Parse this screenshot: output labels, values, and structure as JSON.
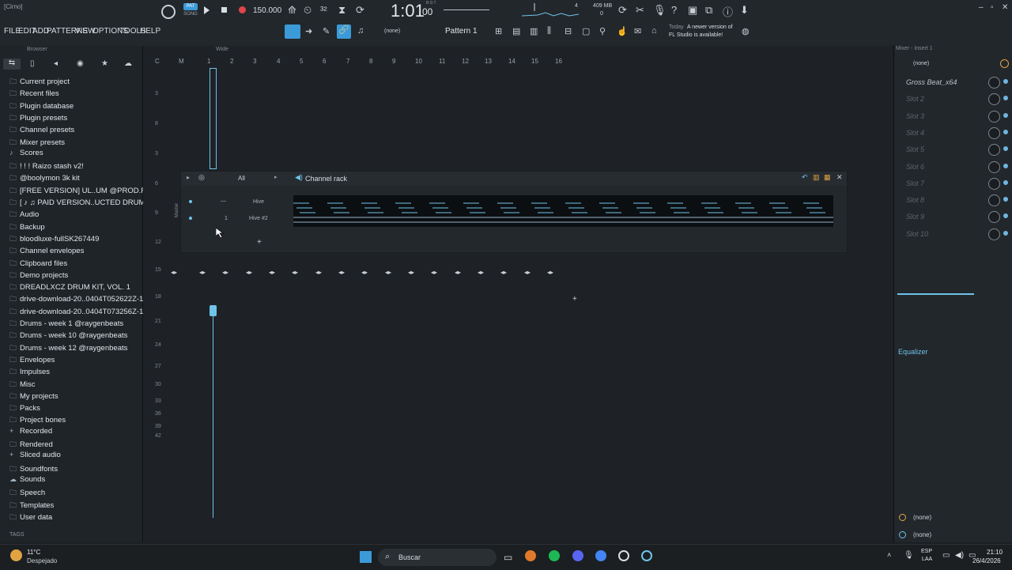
{
  "window": {
    "title": "[Cirno]"
  },
  "menu": [
    "FILE",
    "EDIT",
    "ADD",
    "PATTERNS",
    "VIEW",
    "OPTIONS",
    "TOOLS",
    "HELP"
  ],
  "transport": {
    "mode_top": "PAT",
    "mode_bottom": "SONG",
    "tempo": "150.000",
    "time": "1:01",
    "time_sub": "00",
    "time_label": "B:S:T",
    "memory": "409 MB",
    "memory_sub": "0",
    "cpu": "4"
  },
  "toolbar": {
    "pattern_select": "(none)",
    "pattern_name": "Pattern 1",
    "news_date": "Today",
    "news_text_1": "A newer version of",
    "news_text_2": "FL Studio is available!"
  },
  "browser": {
    "title": "Browser",
    "items": [
      {
        "label": "Current project",
        "icon": "folder"
      },
      {
        "label": "Recent files",
        "icon": "folder"
      },
      {
        "label": "Plugin database",
        "icon": "folder"
      },
      {
        "label": "Plugin presets",
        "icon": "folder"
      },
      {
        "label": "Channel presets",
        "icon": "folder"
      },
      {
        "label": "Mixer presets",
        "icon": "folder"
      },
      {
        "label": "Scores",
        "icon": "note"
      },
      {
        "label": "! ! ! Raizo stash v2!",
        "icon": "folder"
      },
      {
        "label": "@boolymon 3k kit",
        "icon": "folder"
      },
      {
        "label": "[FREE VERSION] UL..UM @PROD.ROSEYY$",
        "icon": "folder"
      },
      {
        "label": "[ ♪ ♫ PAID VERSION..UCTED DRUM KIT",
        "icon": "folder"
      },
      {
        "label": "Audio",
        "icon": "folder"
      },
      {
        "label": "Backup",
        "icon": "folder"
      },
      {
        "label": "bloodluxe-fullSK267449",
        "icon": "folder"
      },
      {
        "label": "Channel envelopes",
        "icon": "folder"
      },
      {
        "label": "Clipboard files",
        "icon": "folder"
      },
      {
        "label": "Demo projects",
        "icon": "folder"
      },
      {
        "label": "DREADLXCZ DRUM KIT, VOL. 1",
        "icon": "folder"
      },
      {
        "label": "drive-download-20..0404T052622Z-1-001",
        "icon": "folder"
      },
      {
        "label": "drive-download-20..0404T073256Z-1-001",
        "icon": "folder"
      },
      {
        "label": "Drums - week 1 @raygenbeats",
        "icon": "folder"
      },
      {
        "label": "Drums - week 10 @raygenbeats",
        "icon": "folder"
      },
      {
        "label": "Drums - week 12 @raygenbeats",
        "icon": "folder"
      },
      {
        "label": "Envelopes",
        "icon": "folder"
      },
      {
        "label": "Impulses",
        "icon": "folder"
      },
      {
        "label": "Misc",
        "icon": "folder"
      },
      {
        "label": "My projects",
        "icon": "folder"
      },
      {
        "label": "Packs",
        "icon": "folder"
      },
      {
        "label": "Project bones",
        "icon": "folder"
      },
      {
        "label": "Recorded",
        "icon": "plus"
      },
      {
        "label": "Rendered",
        "icon": "folder"
      },
      {
        "label": "Sliced audio",
        "icon": "plus"
      },
      {
        "label": "Soundfonts",
        "icon": "folder"
      },
      {
        "label": "Sounds",
        "icon": "cloud"
      },
      {
        "label": "Speech",
        "icon": "folder"
      },
      {
        "label": "Templates",
        "icon": "folder"
      },
      {
        "label": "User data",
        "icon": "folder"
      }
    ],
    "tags_label": "TAGS"
  },
  "playlist": {
    "title": "Wide",
    "ruler": [
      "C",
      "M",
      "1",
      "2",
      "3",
      "4",
      "5",
      "6",
      "7",
      "8",
      "9",
      "10",
      "11",
      "12",
      "13",
      "14",
      "15",
      "16"
    ],
    "row_labels": [
      "3",
      "8",
      "3",
      "6",
      "9",
      "12",
      "15",
      "18",
      "21",
      "24",
      "27",
      "30",
      "33",
      "36",
      "39",
      "42"
    ]
  },
  "channel_rack": {
    "title": "Channel rack",
    "filter": "All",
    "side_label": "Master",
    "channels": [
      {
        "name": "Hive",
        "num": "—"
      },
      {
        "name": "Hive #2",
        "num": "1"
      }
    ]
  },
  "mixer": {
    "title": "Mixer - Insert 1",
    "input": "(none)",
    "slots": [
      "Gross Beat_x64",
      "Slot 2",
      "Slot 3",
      "Slot 4",
      "Slot 5",
      "Slot 6",
      "Slot 7",
      "Slot 8",
      "Slot 9",
      "Slot 10"
    ],
    "eq_label": "Equalizer",
    "out1": "(none)",
    "out2": "(none)"
  },
  "taskbar": {
    "weather_temp": "11°C",
    "weather_desc": "Despejado",
    "search_label": "Buscar",
    "lang_1": "ESP",
    "lang_2": "LAA",
    "time": "21:10",
    "date": "26/4/2026"
  },
  "colors": {
    "accent": "#6fc3e8",
    "bg": "#1e2226",
    "orange": "#e0a443",
    "record": "#e0454a"
  }
}
